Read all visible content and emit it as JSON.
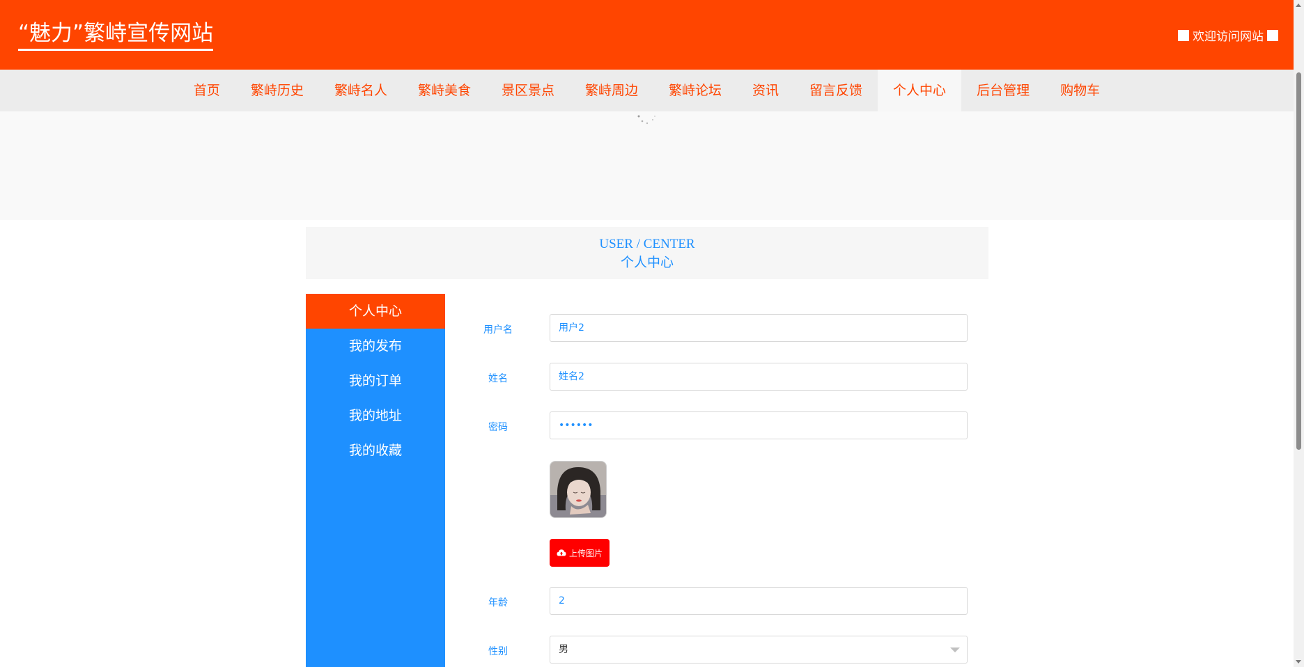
{
  "header": {
    "site_title": "“魅力”繁峙宣传网站",
    "welcome_text": "欢迎访问网站"
  },
  "nav": {
    "items": [
      "首页",
      "繁峙历史",
      "繁峙名人",
      "繁峙美食",
      "景区景点",
      "繁峙周边",
      "繁峙论坛",
      "资讯",
      "留言反馈",
      "个人中心",
      "后台管理",
      "购物车"
    ],
    "active": "个人中心"
  },
  "section": {
    "title_en": "USER / CENTER",
    "title_cn": "个人中心"
  },
  "sidebar": {
    "items": [
      "个人中心",
      "我的发布",
      "我的订单",
      "我的地址",
      "我的收藏"
    ],
    "active": "个人中心"
  },
  "form": {
    "username_label": "用户名",
    "username_value": "用户2",
    "name_label": "姓名",
    "name_value": "姓名2",
    "password_label": "密码",
    "password_value": "••••••",
    "upload_label": "上传图片",
    "age_label": "年龄",
    "age_value": "2",
    "gender_label": "性别",
    "gender_value": "男"
  },
  "colors": {
    "brand": "#ff4500",
    "accent": "#1e90ff",
    "upload": "#ff0000"
  }
}
